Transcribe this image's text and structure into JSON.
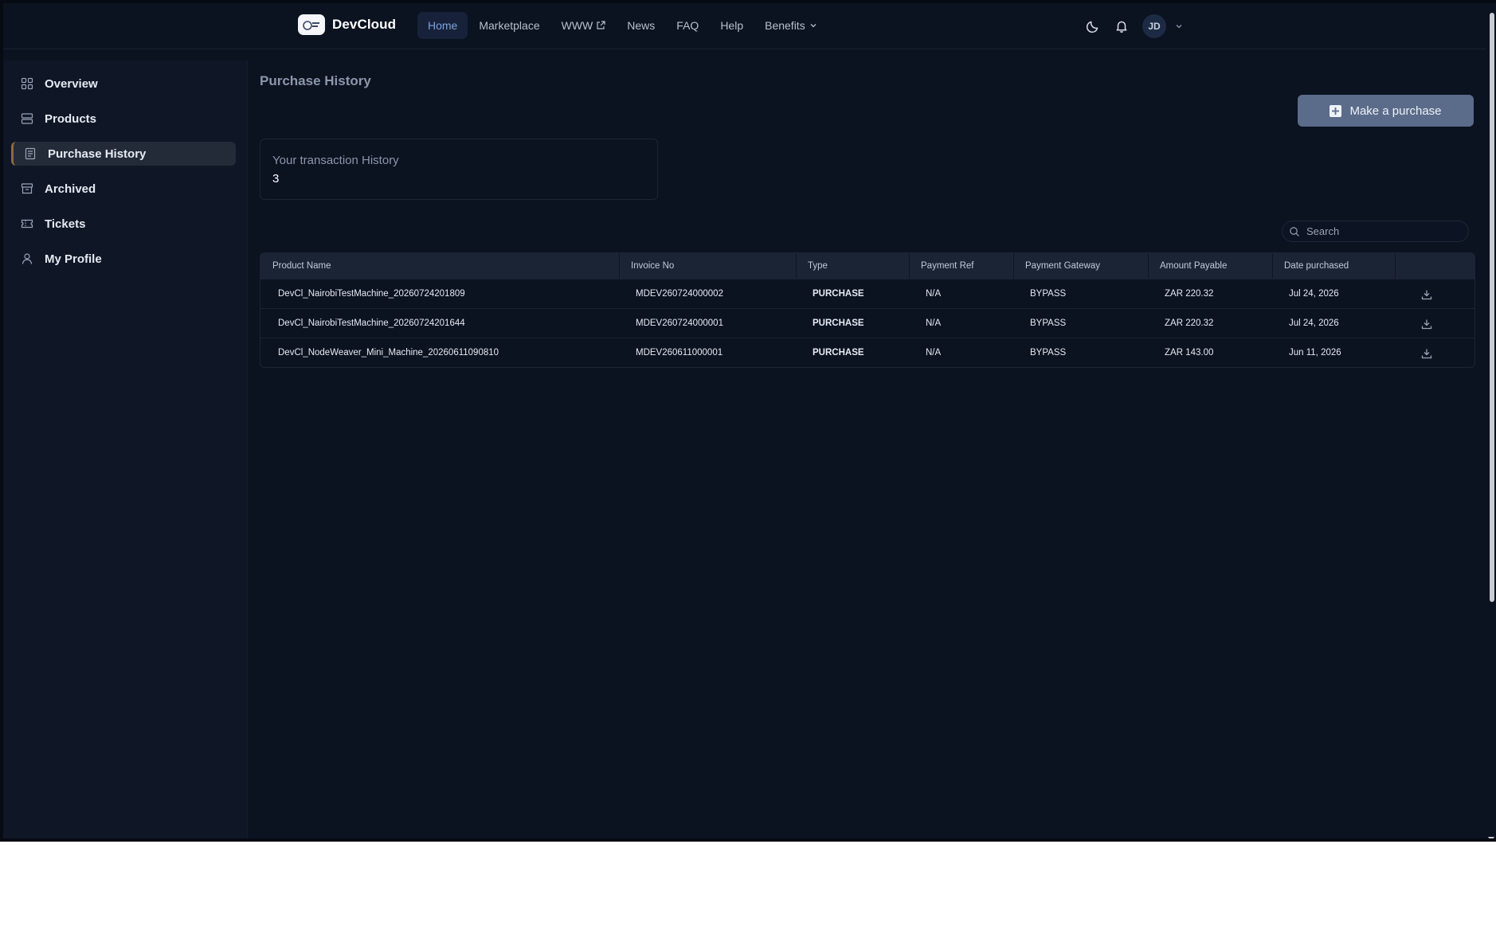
{
  "brand": {
    "name": "DevCloud"
  },
  "nav": {
    "items": [
      {
        "label": "Home",
        "active": true
      },
      {
        "label": "Marketplace"
      },
      {
        "label": "WWW",
        "external": true
      },
      {
        "label": "News"
      },
      {
        "label": "FAQ"
      },
      {
        "label": "Help"
      },
      {
        "label": "Benefits",
        "dropdown": true
      }
    ]
  },
  "user": {
    "initials": "JD"
  },
  "sidebar": {
    "items": [
      {
        "label": "Overview",
        "icon": "grid-icon"
      },
      {
        "label": "Products",
        "icon": "server-icon"
      },
      {
        "label": "Purchase History",
        "icon": "receipt-icon",
        "active": true
      },
      {
        "label": "Archived",
        "icon": "archive-icon"
      },
      {
        "label": "Tickets",
        "icon": "ticket-icon"
      },
      {
        "label": "My Profile",
        "icon": "user-icon"
      }
    ]
  },
  "page": {
    "title": "Purchase History"
  },
  "actions": {
    "make_purchase": "Make a purchase"
  },
  "stat": {
    "label": "Your transaction History",
    "value": "3"
  },
  "search": {
    "placeholder": "Search"
  },
  "table": {
    "headers": [
      "Product Name",
      "Invoice No",
      "Type",
      "Payment Ref",
      "Payment Gateway",
      "Amount Payable",
      "Date purchased"
    ],
    "rows": [
      [
        "DevCl_NairobiTestMachine_20260724201809",
        "MDEV260724000002",
        "PURCHASE",
        "N/A",
        "BYPASS",
        "ZAR 220.32",
        "Jul 24, 2026"
      ],
      [
        "DevCl_NairobiTestMachine_20260724201644",
        "MDEV260724000001",
        "PURCHASE",
        "N/A",
        "BYPASS",
        "ZAR 220.32",
        "Jul 24, 2026"
      ],
      [
        "DevCl_NodeWeaver_Mini_Machine_20260611090810",
        "MDEV260611000001",
        "PURCHASE",
        "N/A",
        "BYPASS",
        "ZAR 143.00",
        "Jun 11, 2026"
      ]
    ]
  },
  "colors": {
    "background": "#0b1220",
    "sidebar": "#0f1727",
    "accent": "#5b6b8a",
    "active_nav": "#7fa0dc"
  }
}
